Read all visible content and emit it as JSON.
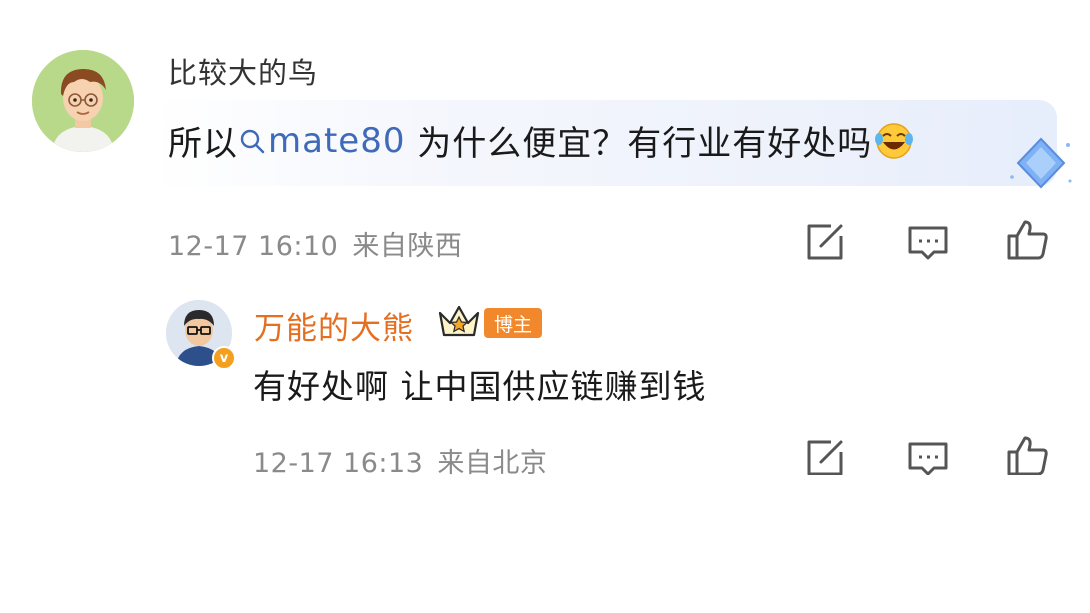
{
  "comment": {
    "username": "比较大的鸟",
    "text_before": "所以",
    "topic": "mate80",
    "text_after": " 为什么便宜？有行业有好处吗",
    "timestamp": "12-17 16:10",
    "location": "来自陕西"
  },
  "reply": {
    "username": "万能的大熊",
    "badge": "博主",
    "verified": "v",
    "text": "有好处啊 让中国供应链赚到钱",
    "timestamp": "12-17 16:13",
    "location": "来自北京"
  },
  "icons": [
    "share-icon",
    "comment-icon",
    "like-icon",
    "crown-icon",
    "search-icon",
    "laugh-cry-emoji",
    "diamond-sticker"
  ],
  "colors": {
    "topic": "#3f6ab8",
    "reply_name": "#e56f20",
    "badge": "#f1892c",
    "meta": "#8a8a8a"
  }
}
